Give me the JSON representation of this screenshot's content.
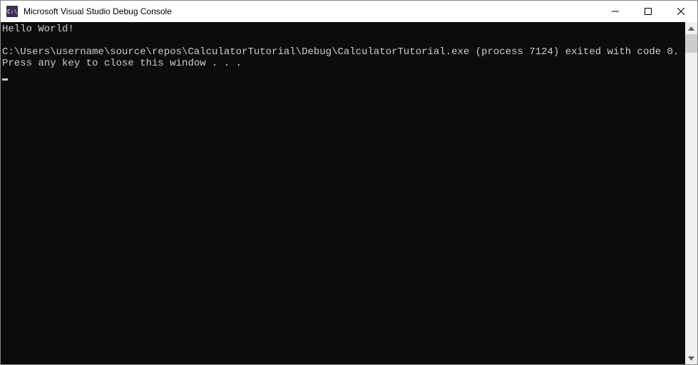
{
  "titlebar": {
    "icon_text": "C:\\",
    "title": "Microsoft Visual Studio Debug Console"
  },
  "console": {
    "line1": "Hello World!",
    "line2": "",
    "line3": "C:\\Users\\username\\source\\repos\\CalculatorTutorial\\Debug\\CalculatorTutorial.exe (process 7124) exited with code 0.",
    "line4": "Press any key to close this window . . ."
  }
}
